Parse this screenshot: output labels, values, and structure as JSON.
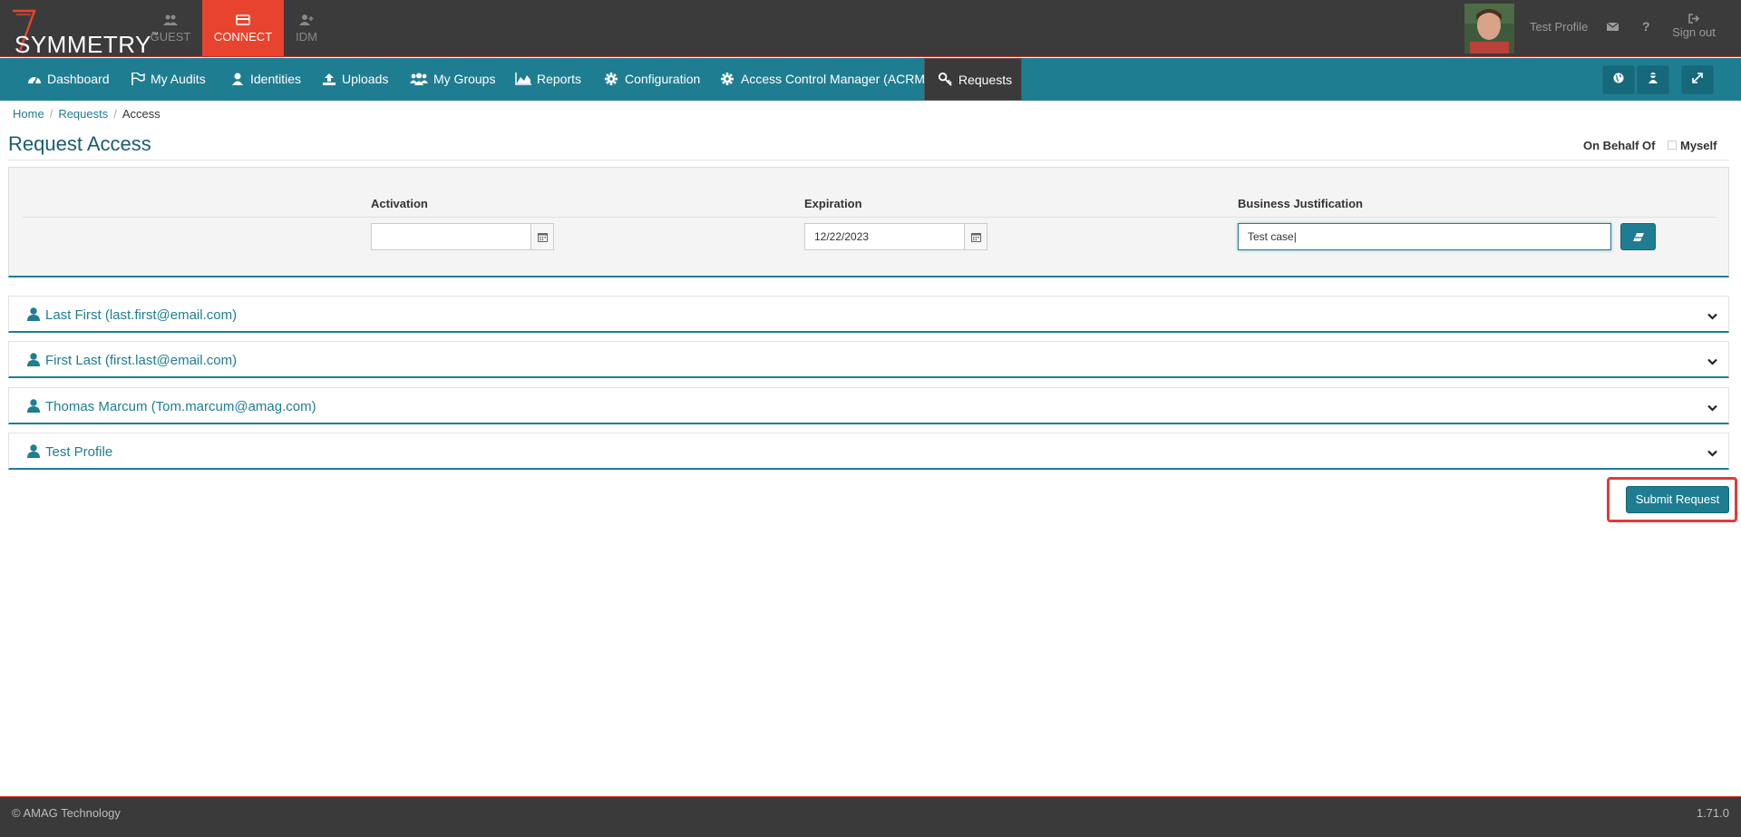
{
  "brand": {
    "name": "SYMMETRY",
    "tm": "™"
  },
  "modules": [
    {
      "label": "GUEST",
      "icon": "users-icon"
    },
    {
      "label": "CONNECT",
      "icon": "card-icon",
      "active": true
    },
    {
      "label": "IDM",
      "icon": "user-plus-icon"
    }
  ],
  "user": {
    "name": "Test Profile",
    "signout": "Sign out"
  },
  "nav": {
    "items": [
      {
        "label": "Dashboard",
        "icon": "dashboard-icon"
      },
      {
        "label": "My Audits",
        "icon": "flag-icon"
      },
      {
        "label": "Identities",
        "icon": "user-icon"
      },
      {
        "label": "Uploads",
        "icon": "upload-icon"
      },
      {
        "label": "My Groups",
        "icon": "group-icon"
      },
      {
        "label": "Reports",
        "icon": "area-chart-icon"
      },
      {
        "label": "Configuration",
        "icon": "gear-icon"
      },
      {
        "label": "Access Control Manager (ACRM)",
        "icon": "gear-icon"
      },
      {
        "label": "Requests",
        "icon": "key-icon",
        "active": true
      }
    ]
  },
  "breadcrumb": {
    "home": "Home",
    "requests": "Requests",
    "current": "Access"
  },
  "page": {
    "title": "Request Access",
    "on_behalf_of": "On Behalf Of",
    "myself": "Myself"
  },
  "form": {
    "activation_label": "Activation",
    "activation_value": "",
    "expiration_label": "Expiration",
    "expiration_value": "12/22/2023",
    "justification_label": "Business Justification",
    "justification_value": "Test case|"
  },
  "recipients": [
    "Last First (last.first@email.com)",
    "First Last (first.last@email.com)",
    "Thomas Marcum (Tom.marcum@amag.com)",
    "Test Profile"
  ],
  "submit_label": "Submit Request",
  "footer": {
    "copyright": "© AMAG Technology",
    "version": "1.71.0"
  },
  "colors": {
    "teal": "#1f7d91",
    "accent_red": "#e8432e",
    "dark": "#3b3b3b"
  }
}
